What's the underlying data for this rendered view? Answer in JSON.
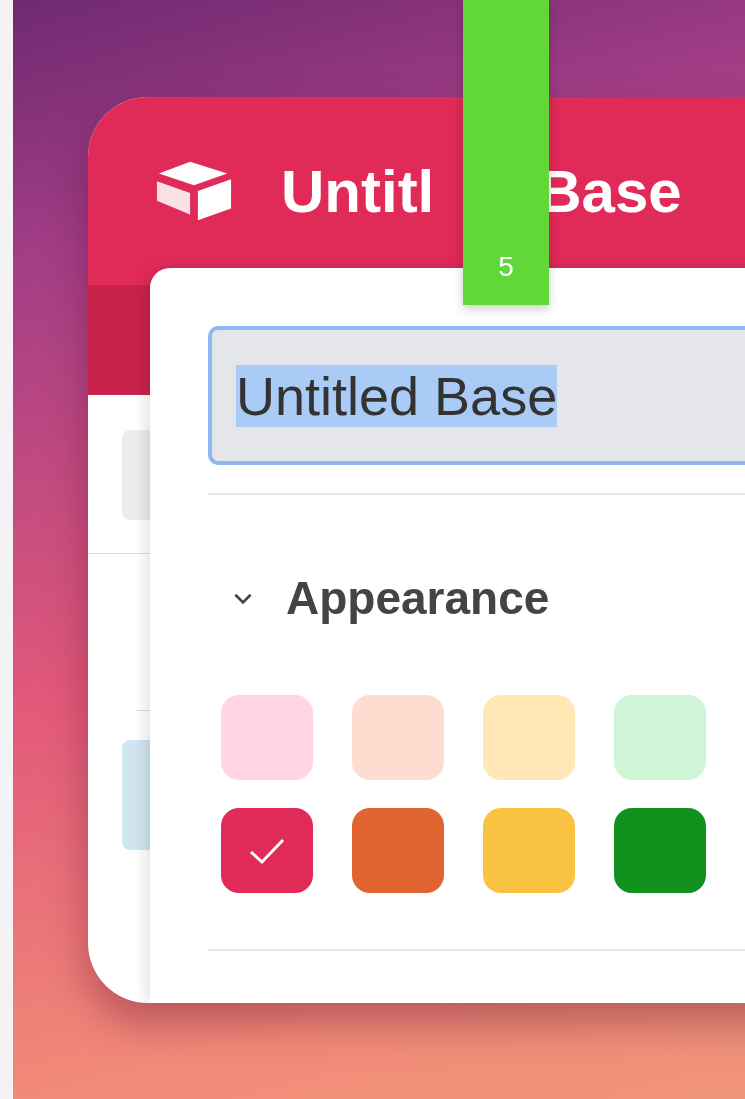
{
  "window": {
    "title_parts": [
      "Untitl",
      "Base"
    ]
  },
  "rename_popover": {
    "name_field": {
      "value": "Untitled Base",
      "text_selected": true
    },
    "section": {
      "title": "Appearance",
      "expanded": true
    },
    "colors": [
      {
        "color": "#ffd6e2",
        "selected": false
      },
      {
        "color": "#ffdcd0",
        "selected": false
      },
      {
        "color": "#ffe8b5",
        "selected": false
      },
      {
        "color": "#d0f4d6",
        "selected": false
      },
      {
        "color": "#e02a57",
        "selected": true
      },
      {
        "color": "#e0642f",
        "selected": false
      },
      {
        "color": "#f9c341",
        "selected": false
      },
      {
        "color": "#11921f",
        "selected": false
      }
    ]
  },
  "step_marker": {
    "label": "5"
  }
}
